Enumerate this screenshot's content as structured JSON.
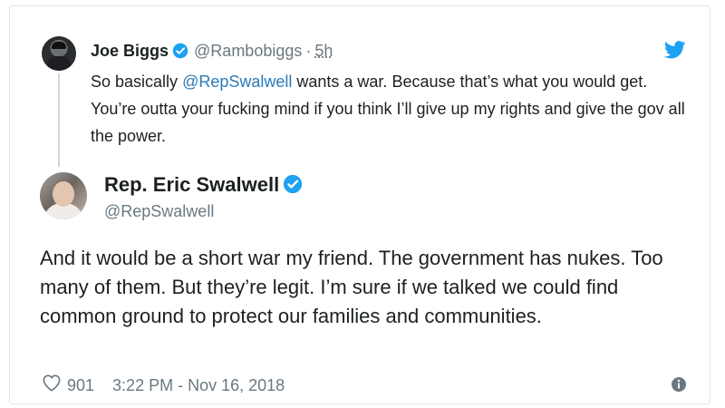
{
  "parent_tweet": {
    "name": "Joe Biggs",
    "handle": "@Rambobiggs",
    "separator": "·",
    "time": "5h",
    "text_before": "So basically ",
    "mention": "@RepSwalwell",
    "text_after": " wants a war. Because that’s what you would get. You’re outta your fucking mind if you think I’ll give up my rights and give the gov all the power."
  },
  "main_tweet": {
    "name": "Rep. Eric Swalwell",
    "handle": "@RepSwalwell",
    "text": "And it would be a short war my friend. The government has nukes. Too many of them. But they’re legit. I’m sure if we talked we could find common ground to protect our families and communities.",
    "likes": "901",
    "timestamp": "3:22 PM - Nov 16, 2018"
  },
  "colors": {
    "verified": "#1da1f2",
    "twitter_bird": "#1da1f2",
    "mention": "#2b7bb9",
    "secondary_text": "#697882"
  },
  "icons": {
    "verified": "verified-badge-icon",
    "bird": "twitter-bird-icon",
    "like": "heart-icon",
    "info": "info-icon"
  }
}
